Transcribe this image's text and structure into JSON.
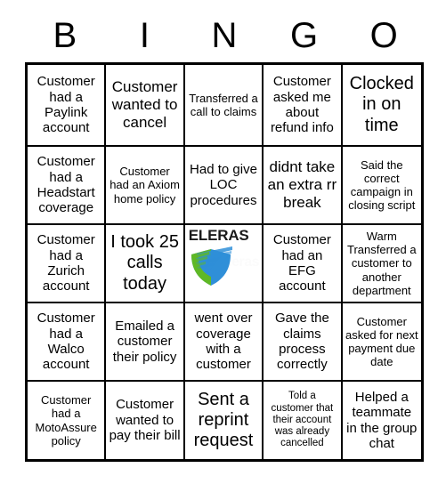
{
  "card": {
    "header_letters": [
      "B",
      "I",
      "N",
      "G",
      "O"
    ],
    "colors": {
      "grid_line": "#000000",
      "cell_background": "#ffffff",
      "text": "#000000",
      "logo_green": "#5fb825",
      "logo_blue": "#2f8fd8",
      "logo_watermark": "#fbfbfb"
    },
    "rows": [
      [
        {
          "text": "Customer had a Paylink account",
          "size": "fs-md"
        },
        {
          "text": "Customer wanted to cancel",
          "size": "fs-lg"
        },
        {
          "text": "Transferred a call to claims",
          "size": "fs-sm"
        },
        {
          "text": "Customer asked me about refund info",
          "size": "fs-md"
        },
        {
          "text": "Clocked in on time",
          "size": "fs-xl"
        }
      ],
      [
        {
          "text": "Customer had a Headstart coverage",
          "size": "fs-md"
        },
        {
          "text": "Customer had an Axiom home policy",
          "size": "fs-sm"
        },
        {
          "text": "Had to give LOC procedures",
          "size": "fs-md"
        },
        {
          "text": "didnt take an extra rr break",
          "size": "fs-lg"
        },
        {
          "text": "Said the correct campaign in closing script",
          "size": "fs-sm"
        }
      ],
      [
        {
          "text": "Customer had a Zurich account",
          "size": "fs-md"
        },
        {
          "text": "I took 25 calls today",
          "size": "fs-xl"
        },
        {
          "text": "ELERAS",
          "size": "logo",
          "logo": true
        },
        {
          "text": "Customer had an EFG account",
          "size": "fs-md"
        },
        {
          "text": "Warm Transferred a customer to another department",
          "size": "fs-sm"
        }
      ],
      [
        {
          "text": "Customer had a Walco account",
          "size": "fs-md"
        },
        {
          "text": "Emailed a customer their policy",
          "size": "fs-md"
        },
        {
          "text": "went over coverage with a customer",
          "size": "fs-md"
        },
        {
          "text": "Gave the claims process correctly",
          "size": "fs-md"
        },
        {
          "text": "Customer asked for next payment due date",
          "size": "fs-sm"
        }
      ],
      [
        {
          "text": "Customer had a MotoAssure policy",
          "size": "fs-sm"
        },
        {
          "text": "Customer wanted to pay their bill",
          "size": "fs-md"
        },
        {
          "text": "Sent a reprint request",
          "size": "fs-xl"
        },
        {
          "text": "Told a customer that their account was already cancelled",
          "size": "fs-xs"
        },
        {
          "text": "Helped a teammate in the group chat",
          "size": "fs-md"
        }
      ]
    ],
    "logo": {
      "word": "ELERAS",
      "watermark": "eleras",
      "mark_name": "eleras-shield-logo"
    }
  }
}
